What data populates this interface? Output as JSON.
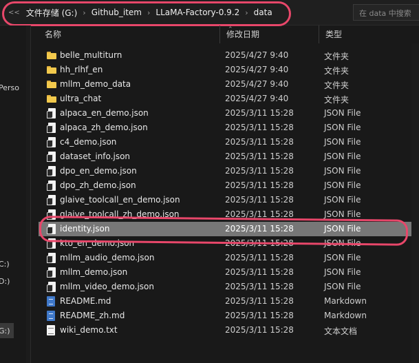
{
  "address": {
    "back_glyph": "<<",
    "crumbs": [
      "文件存储 (G:)",
      "Github_item",
      "LLaMA-Factory-0.9.2",
      "data"
    ],
    "separator": "›"
  },
  "search": {
    "placeholder": "在 data 中搜索"
  },
  "nav": {
    "items": [
      "Perso",
      "C:)",
      "D:)",
      "G:)"
    ]
  },
  "columns": {
    "name": "名称",
    "date": "修改日期",
    "type": "类型"
  },
  "files": [
    {
      "icon": "folder-icon",
      "name": "belle_multiturn",
      "date": "2025/4/27 9:40",
      "type": "文件夹"
    },
    {
      "icon": "folder-icon",
      "name": "hh_rlhf_en",
      "date": "2025/4/27 9:40",
      "type": "文件夹"
    },
    {
      "icon": "folder-icon",
      "name": "mllm_demo_data",
      "date": "2025/4/27 9:40",
      "type": "文件夹"
    },
    {
      "icon": "folder-icon",
      "name": "ultra_chat",
      "date": "2025/4/27 9:40",
      "type": "文件夹"
    },
    {
      "icon": "json-file-icon",
      "name": "alpaca_en_demo.json",
      "date": "2025/3/11 15:28",
      "type": "JSON File"
    },
    {
      "icon": "json-file-icon",
      "name": "alpaca_zh_demo.json",
      "date": "2025/3/11 15:28",
      "type": "JSON File"
    },
    {
      "icon": "json-file-icon",
      "name": "c4_demo.json",
      "date": "2025/3/11 15:28",
      "type": "JSON File"
    },
    {
      "icon": "json-file-icon",
      "name": "dataset_info.json",
      "date": "2025/3/11 15:28",
      "type": "JSON File"
    },
    {
      "icon": "json-file-icon",
      "name": "dpo_en_demo.json",
      "date": "2025/3/11 15:28",
      "type": "JSON File"
    },
    {
      "icon": "json-file-icon",
      "name": "dpo_zh_demo.json",
      "date": "2025/3/11 15:28",
      "type": "JSON File"
    },
    {
      "icon": "json-file-icon",
      "name": "glaive_toolcall_en_demo.json",
      "date": "2025/3/11 15:28",
      "type": "JSON File"
    },
    {
      "icon": "json-file-icon",
      "name": "glaive_toolcall_zh_demo.json",
      "date": "2025/3/11 15:28",
      "type": "JSON File"
    },
    {
      "icon": "json-file-icon",
      "name": "identity.json",
      "date": "2025/3/11 15:28",
      "type": "JSON File",
      "selected": true
    },
    {
      "icon": "json-file-icon",
      "name": "kto_en_demo.json",
      "date": "2025/3/11 15:28",
      "type": "JSON File"
    },
    {
      "icon": "json-file-icon",
      "name": "mllm_audio_demo.json",
      "date": "2025/3/11 15:28",
      "type": "JSON File"
    },
    {
      "icon": "json-file-icon",
      "name": "mllm_demo.json",
      "date": "2025/3/11 15:28",
      "type": "JSON File"
    },
    {
      "icon": "json-file-icon",
      "name": "mllm_video_demo.json",
      "date": "2025/3/11 15:28",
      "type": "JSON File"
    },
    {
      "icon": "markdown-file-icon",
      "name": "README.md",
      "date": "2025/3/11 15:28",
      "type": "Markdown"
    },
    {
      "icon": "markdown-file-icon",
      "name": "README_zh.md",
      "date": "2025/3/11 15:28",
      "type": "Markdown"
    },
    {
      "icon": "text-file-icon",
      "name": "wiki_demo.txt",
      "date": "2025/3/11 15:28",
      "type": "文本文档"
    }
  ],
  "colors": {
    "background": "#191919",
    "selected_row": "#777777",
    "highlight_ring": "#e8476a",
    "folder": "#f2c94c"
  }
}
